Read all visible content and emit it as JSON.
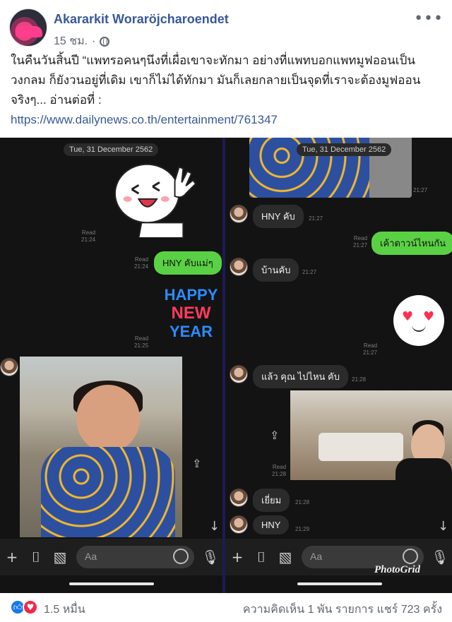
{
  "post": {
    "author": "Akararkit Woraröjcharoendet",
    "time": "15 ชม.",
    "text": "ในคืนวันสิ้นปี “แพทรอคนๆนึงที่เผื่อเขาจะทักมา อย่างที่แพทบอกแพทมูฟออนเป็นวงกลม ก็ยังวนอยู่ที่เดิม เขาก็ไม่ได้ทักมา มันก็เลยกลายเป็นจุดที่เราจะต้องมูฟออนจริงๆ... อ่านต่อที่ :",
    "link": "https://www.dailynews.co.th/entertainment/761347",
    "icons": {
      "privacy": "globe-icon",
      "more": "more-options-icon"
    }
  },
  "left_chat": {
    "date": "Tue, 31 December 2562",
    "read_1": "Read\n21:24",
    "read_2": "Read\n21:24",
    "message_1": "HNY คับแม่ๆ",
    "read_3": "Read\n21:25",
    "sticker_text": [
      "HAPPY",
      "NEW",
      "YEAR"
    ]
  },
  "right_chat": {
    "date": "Tue, 31 December 2562",
    "time_1": "21:27",
    "msg_1": "HNY คับ",
    "time_2": "21:27",
    "read_out_1": "Read\n21:27",
    "out_1": "เค้าดาวน์ไหนกัน",
    "msg_2": "บ้านคับ",
    "time_3": "21:27",
    "read_out_2": "Read\n21:27",
    "msg_3": "แล้ว คุณ ไปไหน คับ",
    "time_4": "21:28",
    "read_out_3": "Read\n21:28",
    "msg_4": "เยี่ยม",
    "time_5": "21:28",
    "msg_5": "HNY",
    "time_6": "21:29"
  },
  "chatbar": {
    "placeholder": "Aa",
    "icons": [
      "plus-icon",
      "camera-icon",
      "image-icon",
      "emoji-icon",
      "microphone-icon"
    ]
  },
  "watermark": "PhotoGrid",
  "footer": {
    "reactions_count": "1.5 หมื่น",
    "stats": "ความคิดเห็น 1 พัน รายการ  แชร์ 723 ครั้ง"
  }
}
